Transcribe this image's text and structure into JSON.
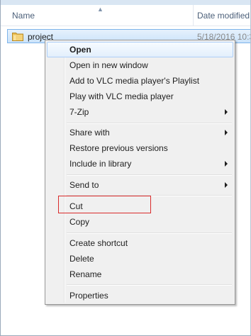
{
  "columns": {
    "name": "Name",
    "date_modified": "Date modified"
  },
  "file": {
    "name": "project",
    "date_modified": "5/18/2016 10:3",
    "icon": "folder-icon"
  },
  "context_menu": {
    "items": [
      {
        "label": "Open",
        "bold": true,
        "submenu": false
      },
      {
        "label": "Open in new window",
        "submenu": false
      },
      {
        "label": "Add to VLC media player's Playlist",
        "submenu": false
      },
      {
        "label": "Play with VLC media player",
        "submenu": false
      },
      {
        "label": "7-Zip",
        "submenu": true
      },
      {
        "label": "Share with",
        "submenu": true
      },
      {
        "label": "Restore previous versions",
        "submenu": false
      },
      {
        "label": "Include in library",
        "submenu": true
      },
      {
        "label": "Send to",
        "submenu": true
      },
      {
        "label": "Cut",
        "submenu": false,
        "highlighted": true
      },
      {
        "label": "Copy",
        "submenu": false
      },
      {
        "label": "Create shortcut",
        "submenu": false
      },
      {
        "label": "Delete",
        "submenu": false
      },
      {
        "label": "Rename",
        "submenu": false
      },
      {
        "label": "Properties",
        "submenu": false
      }
    ]
  },
  "colors": {
    "highlight_box": "#d92b2b",
    "selection": "#cbe3fa",
    "menu_bg": "#f0f0f0"
  }
}
